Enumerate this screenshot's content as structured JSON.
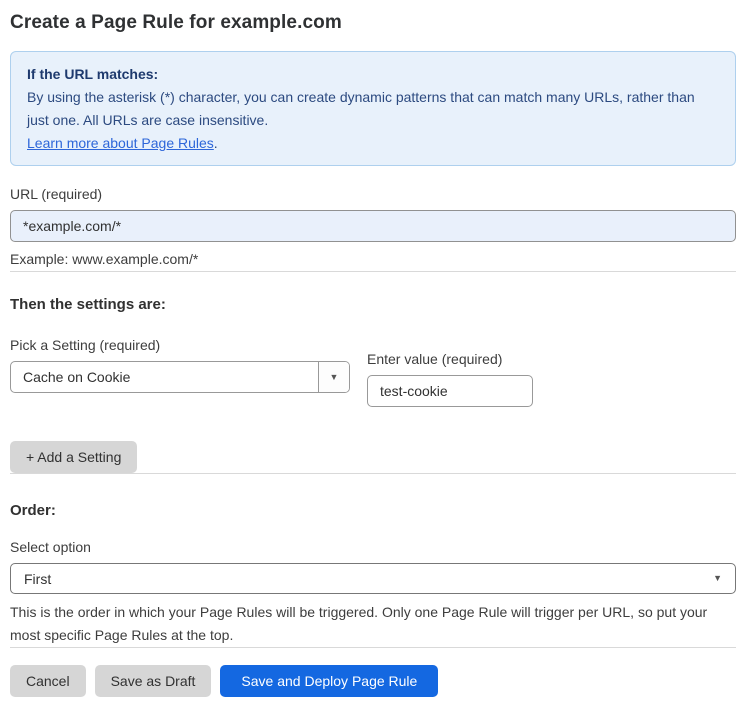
{
  "page": {
    "title": "Create a Page Rule for example.com"
  },
  "info_box": {
    "heading": "If the URL matches:",
    "body": "By using the asterisk (*) character, you can create dynamic patterns that can match many URLs, rather than just one. All URLs are case insensitive.",
    "link_label": "Learn more about Page Rules",
    "link_suffix": "."
  },
  "url_field": {
    "label": "URL (required)",
    "value": "*example.com/*",
    "helper": "Example: www.example.com/*"
  },
  "settings_section": {
    "heading": "Then the settings are:",
    "setting_select": {
      "label": "Pick a Setting (required)",
      "value": "Cache on Cookie"
    },
    "value_field": {
      "label": "Enter value (required)",
      "value": "test-cookie"
    },
    "add_setting_label": "+ Add a Setting"
  },
  "order_section": {
    "heading": "Order:",
    "select_label": "Select option",
    "select_value": "First",
    "helper": "This is the order in which your Page Rules will be triggered. Only one Page Rule will trigger per URL, so put your most specific Page Rules at the top."
  },
  "footer": {
    "cancel_label": "Cancel",
    "save_draft_label": "Save as Draft",
    "save_deploy_label": "Save and Deploy Page Rule"
  },
  "icons": {
    "dropdown_arrow": "▼"
  },
  "colors": {
    "accent_blue": "#1468e1",
    "info_bg": "#e8f1fb",
    "info_border": "#aed0ee",
    "info_heading_text": "#1e3a6e",
    "info_body_text": "#2c4a80",
    "link_blue": "#2d66d9",
    "url_input_bg": "#e9f0fb",
    "button_gray": "#d6d6d6",
    "divider_gray": "#d9d9d9"
  }
}
